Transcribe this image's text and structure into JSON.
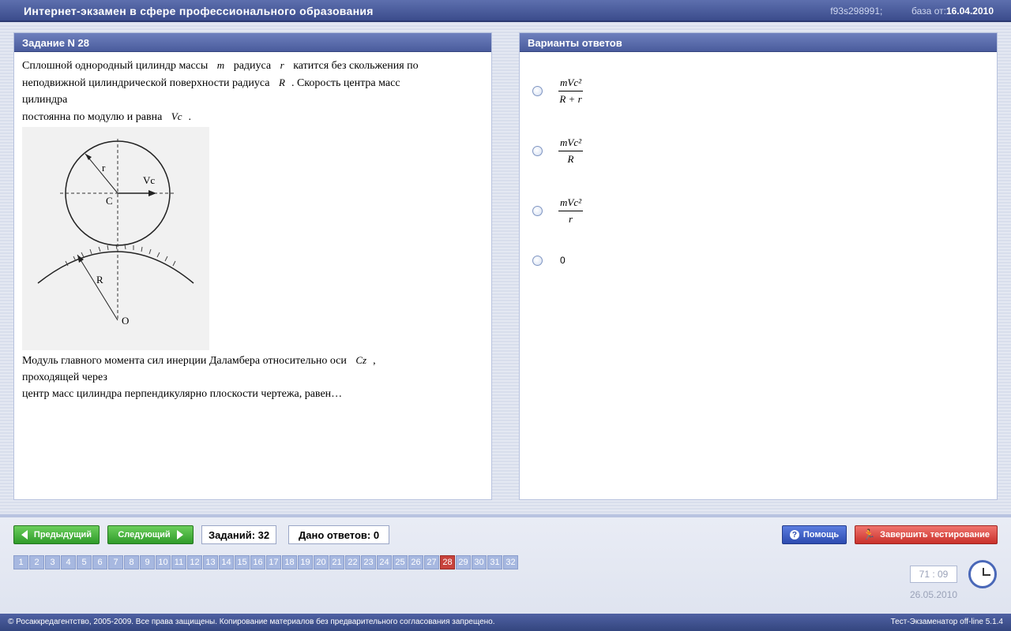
{
  "header": {
    "title": "Интернет-экзамен в сфере профессионального образования",
    "session_id": "f93s298991;",
    "base_label": "база от:",
    "base_date": "16.04.2010"
  },
  "task": {
    "header": "Задание N 28",
    "line1_a": "Сплошной однородный цилиндр массы",
    "var_m": "m",
    "line1_b": "радиуса",
    "var_r": "r",
    "line1_c": "катится без скольжения по",
    "line2_a": "неподвижной цилиндрической поверхности радиуса",
    "var_R": "R",
    "line2_b": ". Скорость центра масс",
    "line3": "цилиндра",
    "line4_a": "постоянна по модулю и равна",
    "var_Vc": "Vc",
    "line4_b": ".",
    "figure_labels": {
      "r": "r",
      "vc": "Vc",
      "c": "C",
      "R": "R",
      "o": "O"
    },
    "q1_a": "Модуль главного момента сил инерции Даламбера относительно оси",
    "var_Cz": "Cz",
    "q1_b": ",",
    "q2": "проходящей через",
    "q3": "центр масс цилиндра перпендикулярно плоскости чертежа, равен…"
  },
  "answers": {
    "header": "Варианты ответов",
    "options": [
      {
        "num": "mVc²",
        "den": "R + r"
      },
      {
        "num": "mVc²",
        "den": "R"
      },
      {
        "num": "mVc²",
        "den": "r"
      },
      {
        "text": "0"
      }
    ]
  },
  "controls": {
    "prev": "Предыдущий",
    "next": "Следующий",
    "tasks_count": "Заданий: 32",
    "answered": "Дано ответов: 0",
    "help": "Помощь",
    "finish": "Завершить тестирование"
  },
  "question_numbers": [
    "1",
    "2",
    "3",
    "4",
    "5",
    "6",
    "7",
    "8",
    "9",
    "10",
    "11",
    "12",
    "13",
    "14",
    "15",
    "16",
    "17",
    "18",
    "19",
    "20",
    "21",
    "22",
    "23",
    "24",
    "25",
    "26",
    "27",
    "28",
    "29",
    "30",
    "31",
    "32"
  ],
  "active_question": "28",
  "timer": "71 : 09",
  "date": "26.05.2010",
  "footer": {
    "left": "© Росаккредагентство, 2005-2009. Все права защищены. Копирование материалов без предварительного согласования запрещено.",
    "right": "Тест-Экзаменатор off-line 5.1.4"
  },
  "colors": {
    "accent": "#4a5c9d",
    "green": "#2f9b2a",
    "red": "#c9302a",
    "active_number": "#c8433c"
  }
}
